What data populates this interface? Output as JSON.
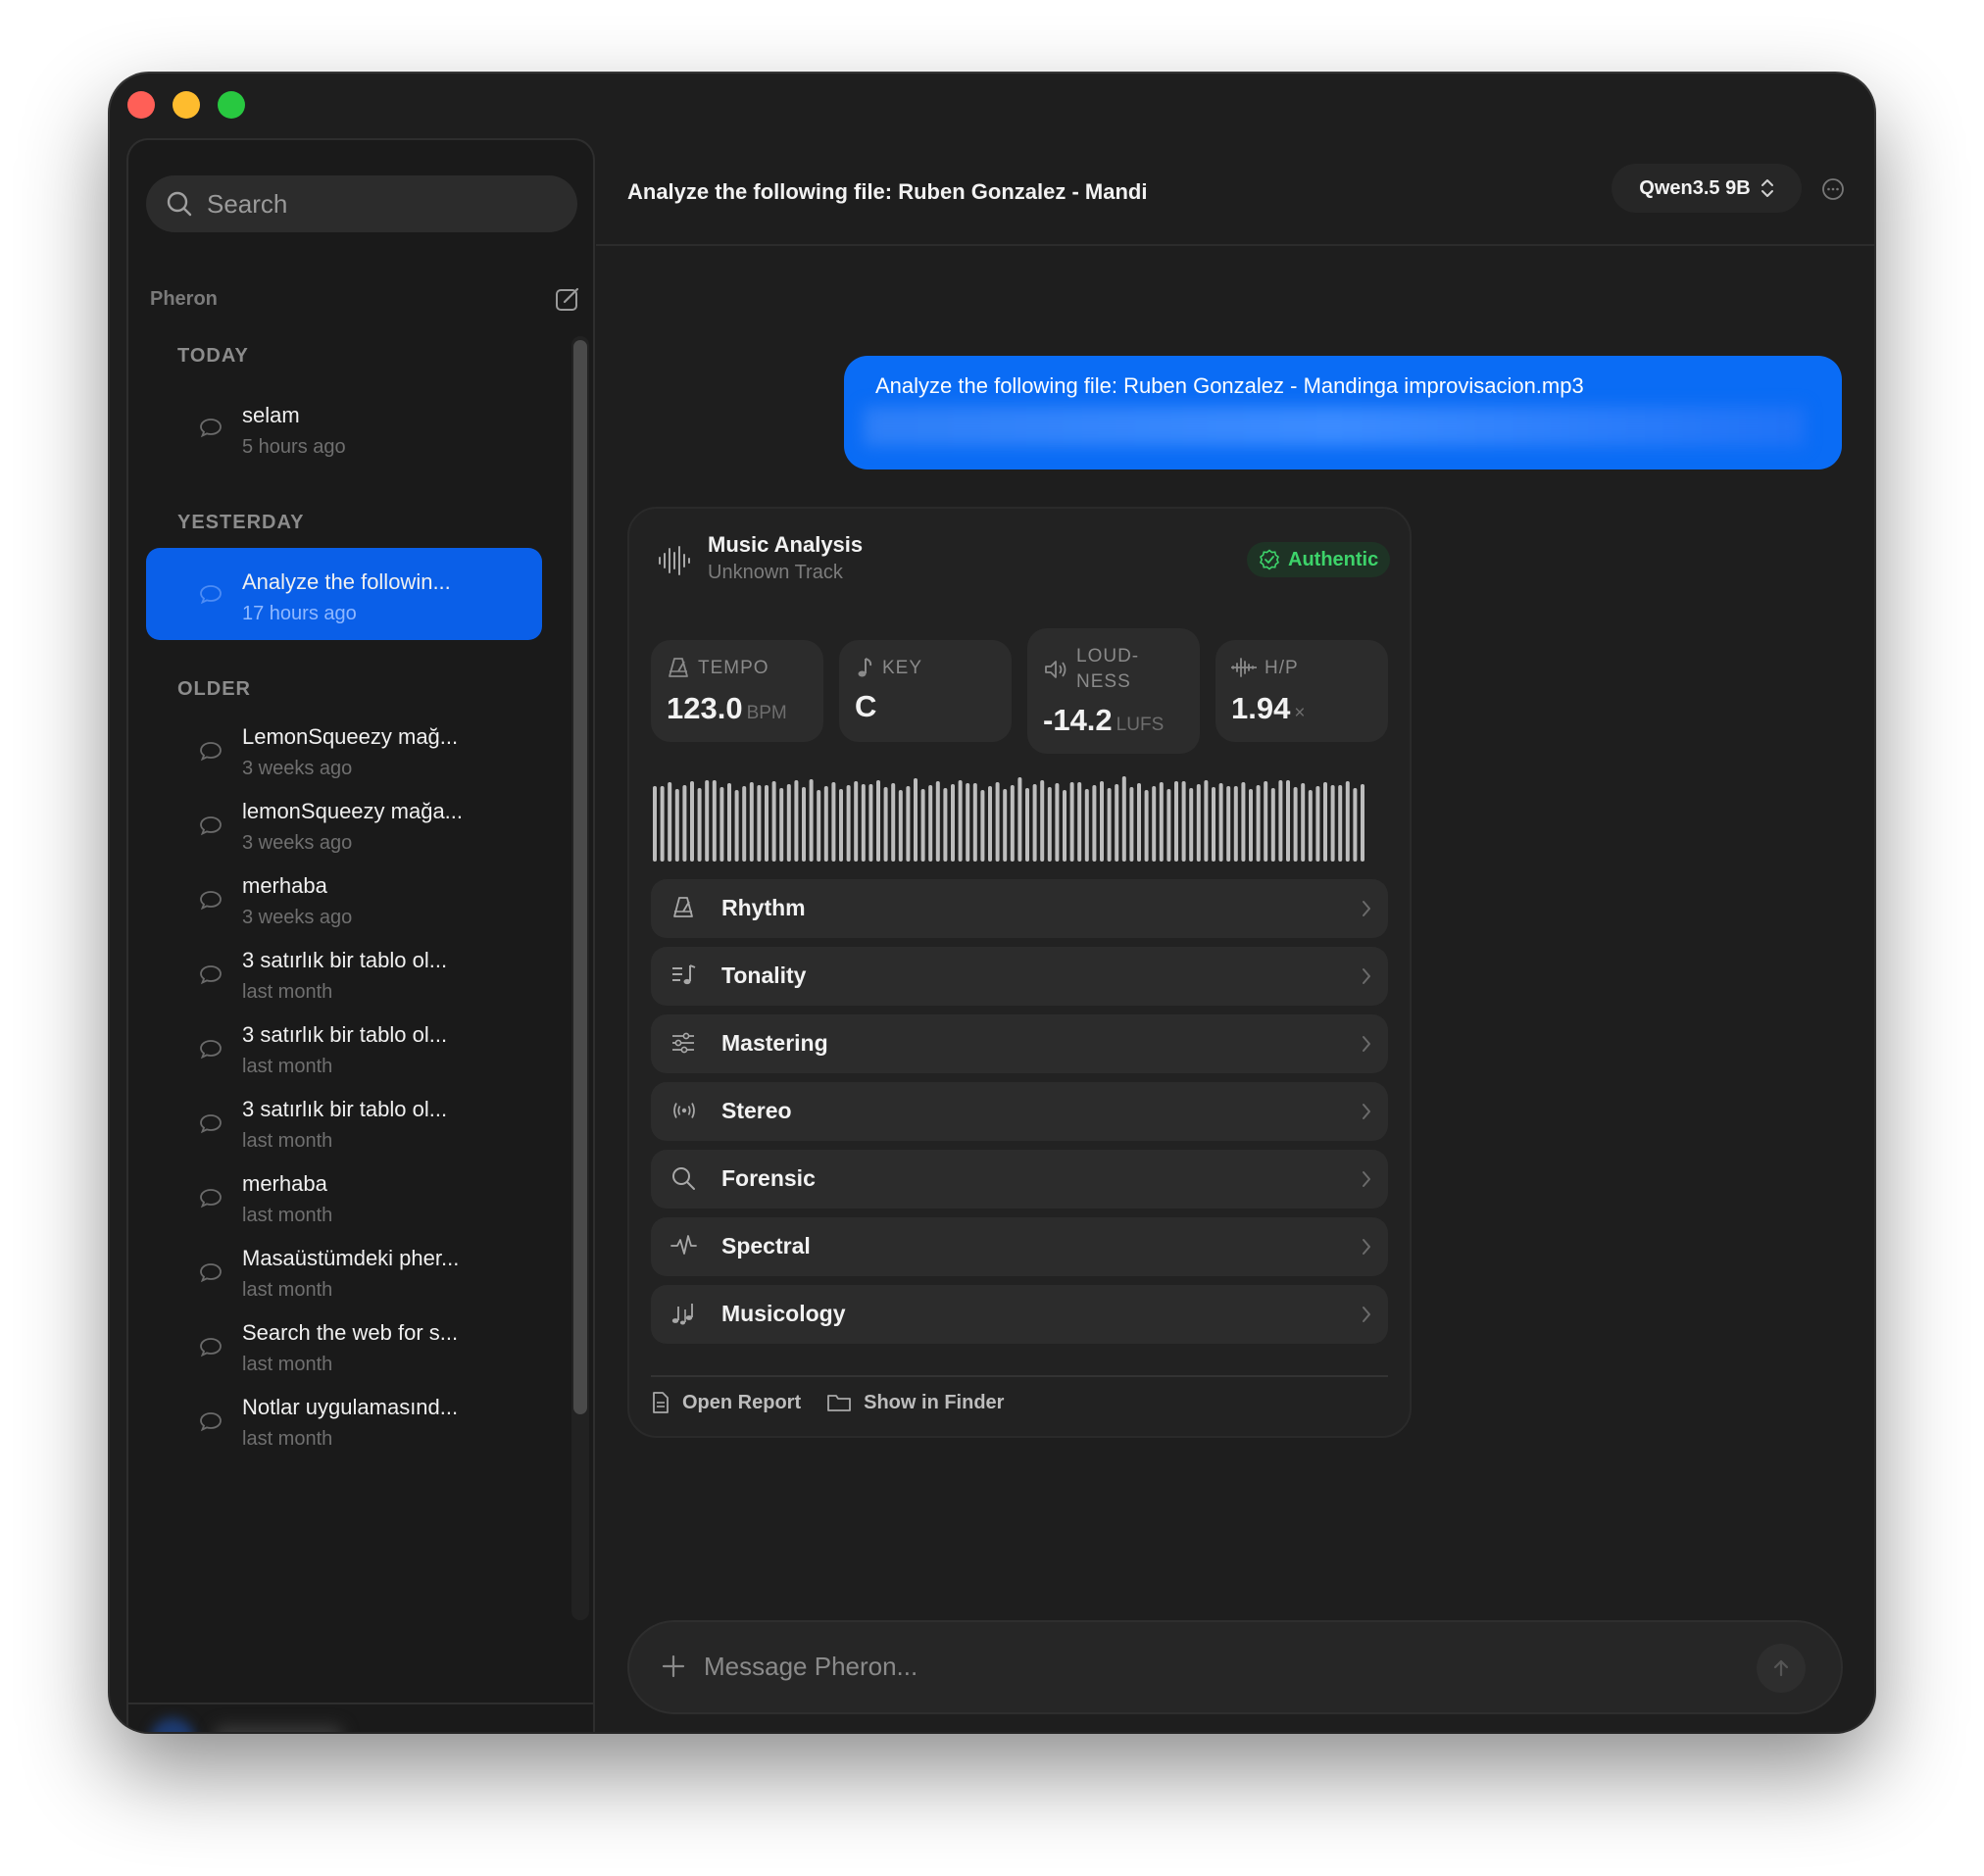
{
  "window": {
    "traffic_lights": [
      "close",
      "minimize",
      "zoom"
    ]
  },
  "sidebar": {
    "search_placeholder": "Search",
    "app_name": "Pheron",
    "new_chat_icon": "compose-icon",
    "sections": [
      {
        "label": "TODAY",
        "items": [
          {
            "title": "selam",
            "time": "5 hours ago",
            "active": false
          }
        ]
      },
      {
        "label": "YESTERDAY",
        "items": [
          {
            "title": "Analyze the followin...",
            "time": "17 hours ago",
            "active": true
          }
        ]
      },
      {
        "label": "OLDER",
        "items": [
          {
            "title": "LemonSqueezy mağ...",
            "time": "3 weeks ago",
            "active": false
          },
          {
            "title": "lemonSqueezy mağa...",
            "time": "3 weeks ago",
            "active": false
          },
          {
            "title": "merhaba",
            "time": "3 weeks ago",
            "active": false
          },
          {
            "title": "3 satırlık bir tablo ol...",
            "time": "last month",
            "active": false
          },
          {
            "title": "3 satırlık bir tablo ol...",
            "time": "last month",
            "active": false
          },
          {
            "title": "3 satırlık bir tablo ol...",
            "time": "last month",
            "active": false
          },
          {
            "title": "merhaba",
            "time": "last month",
            "active": false
          },
          {
            "title": "Masaüstümdeki pher...",
            "time": "last month",
            "active": false
          },
          {
            "title": "Search the web for s...",
            "time": "last month",
            "active": false
          },
          {
            "title": "Notlar uygulamasınd...",
            "time": "last month",
            "active": false
          }
        ]
      }
    ]
  },
  "header": {
    "title": "Analyze the following file: Ruben Gonzalez - Mandi",
    "model": "Qwen3.5 9B"
  },
  "message": {
    "user_text": "Analyze the following file: Ruben Gonzalez - Mandinga improvisacion.mp3"
  },
  "analysis": {
    "title": "Music Analysis",
    "subtitle": "Unknown Track",
    "badge": "Authentic",
    "accent_color": "#3dd36a",
    "stats": {
      "tempo": {
        "label": "TEMPO",
        "value": "123.0",
        "unit": "BPM"
      },
      "key": {
        "label": "KEY",
        "value": "C"
      },
      "loudness": {
        "label_line1": "LOUD-",
        "label_line2": "NESS",
        "value": "-14.2",
        "unit": "LUFS"
      },
      "hp": {
        "label": "H/P",
        "value": "1.94",
        "unit": "×"
      }
    },
    "sections": [
      {
        "label": "Rhythm",
        "icon": "metronome-icon"
      },
      {
        "label": "Tonality",
        "icon": "music-note-list-icon"
      },
      {
        "label": "Mastering",
        "icon": "sliders-icon"
      },
      {
        "label": "Stereo",
        "icon": "broadcast-icon"
      },
      {
        "label": "Forensic",
        "icon": "magnifier-icon"
      },
      {
        "label": "Spectral",
        "icon": "waveform-pulse-icon"
      },
      {
        "label": "Musicology",
        "icon": "music-notes-icon"
      }
    ],
    "actions": {
      "open_report": "Open Report",
      "show_in_finder": "Show in Finder"
    }
  },
  "composer": {
    "placeholder": "Message Pheron..."
  }
}
